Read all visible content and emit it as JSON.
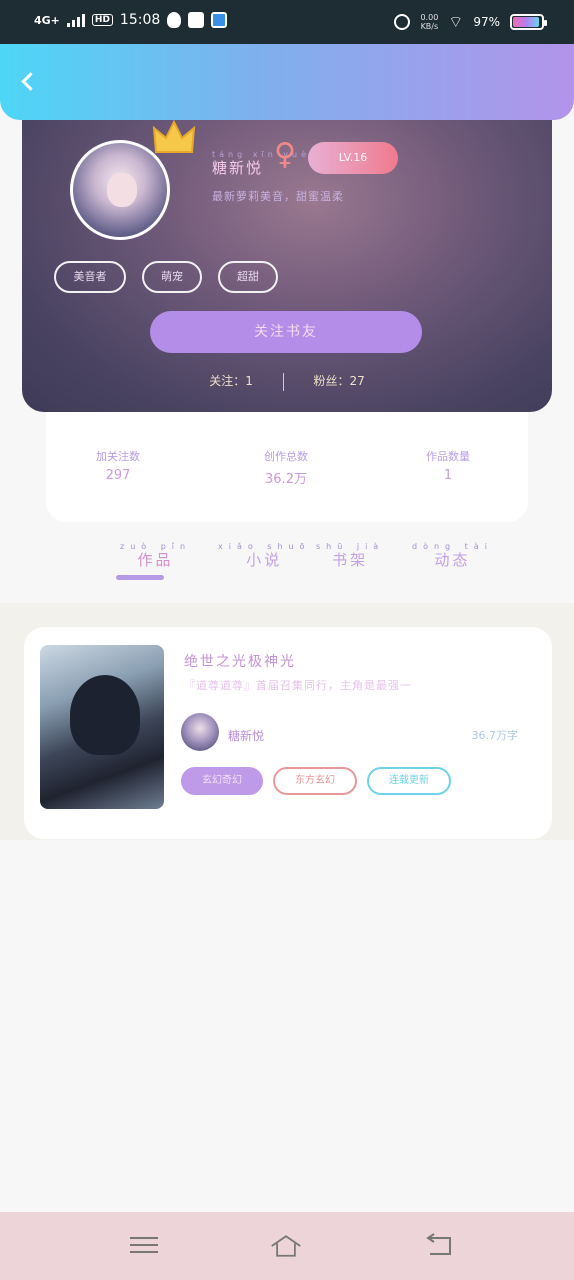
{
  "status_bar": {
    "network": "4G+",
    "hd": "HD",
    "time": "15:08",
    "speed_value": "0.00",
    "speed_unit": "KB/s",
    "battery": "97%"
  },
  "header": {
    "back_icon": "chevron-left-icon"
  },
  "profile": {
    "username_pinyin": "táng xīn yuè",
    "username": "糖新悦",
    "gender_symbol": "♀",
    "vip_label": "LV.16",
    "bio": "最新萝莉美音，甜蜜温柔",
    "tags": [
      "美音者",
      "萌宠",
      "超甜"
    ],
    "follow_button": "关注书友",
    "following_label": "关注：",
    "following_value": "1",
    "fans_label": "粉丝：",
    "fans_value": "27"
  },
  "stats": [
    {
      "label": "加关注数",
      "value": "297"
    },
    {
      "label": "创作总数",
      "value": "36.2万"
    },
    {
      "label": "作品数量",
      "value": "1"
    }
  ],
  "tabs": [
    {
      "pinyin": "zuò pǐn",
      "label": "作品",
      "active": true
    },
    {
      "pinyin": "xiǎo shuō",
      "label": "小说",
      "active": false
    },
    {
      "pinyin": "shū jià",
      "label": "书架",
      "active": false
    },
    {
      "pinyin": "dòng tài",
      "label": "动态",
      "active": false
    }
  ],
  "novel": {
    "title": "绝世之光极神光",
    "desc": "『道尊道尊』首届召集同行，主角是最强一",
    "author": "糖新悦",
    "word_count": "36.7万字",
    "tags": [
      "玄幻奇幻",
      "东方玄幻",
      "连载更新"
    ]
  },
  "colors": {
    "header_start": "#4ed6f7",
    "header_end": "#b294ea",
    "accent": "#b48de8",
    "navbar": "#ecd4d8"
  }
}
